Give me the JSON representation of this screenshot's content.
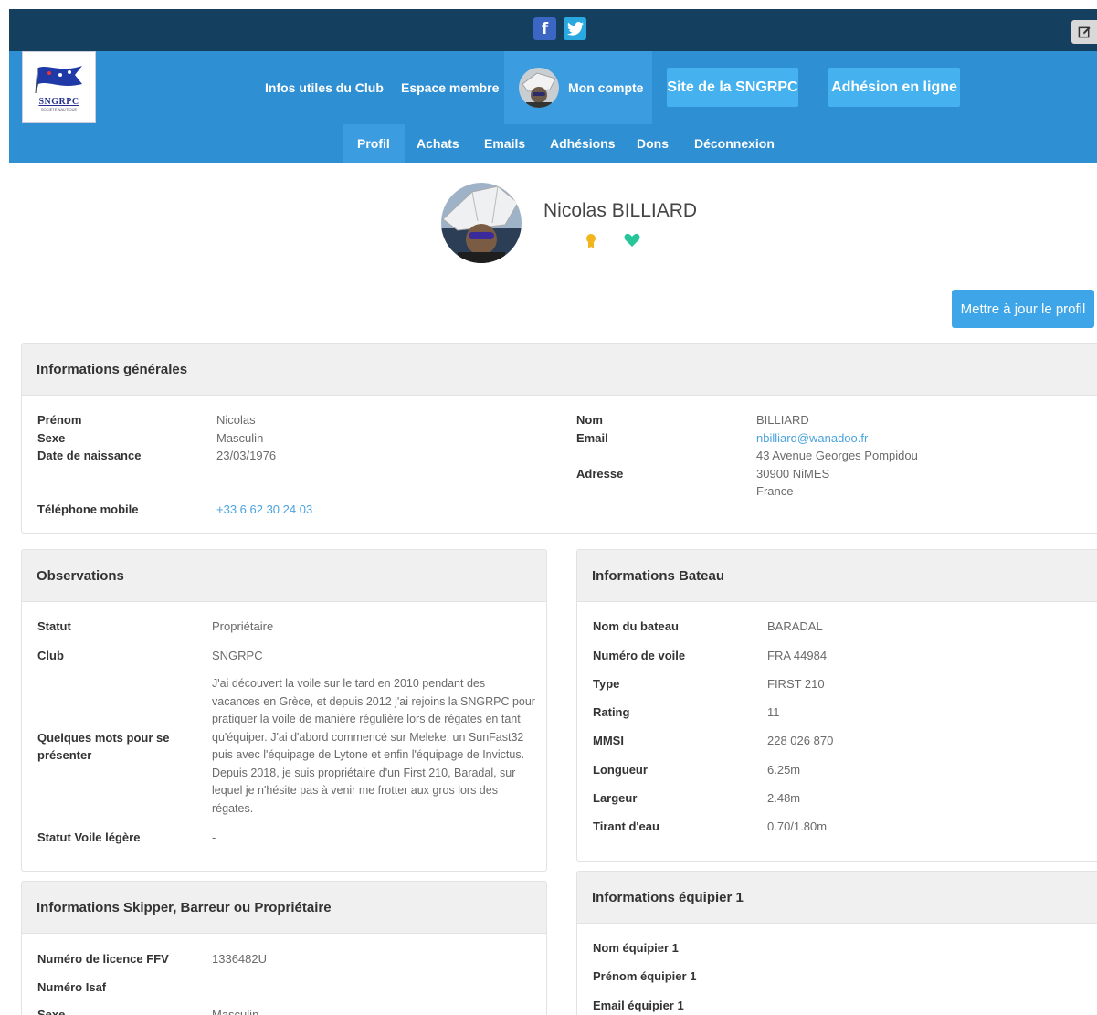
{
  "social": {
    "facebook": "f",
    "twitter": "t"
  },
  "nav": {
    "logo_text": "SNGRPC",
    "logo_sub": "SOCIÉTÉ NAUTIQUE",
    "links": [
      "Infos utiles du Club",
      "Espace membre"
    ],
    "account": "Mon compte",
    "site_btn": "Site de la SNGRPC",
    "adhesion_btn": "Adhésion en ligne"
  },
  "subnav": [
    "Profil",
    "Achats",
    "Emails",
    "Adhésions",
    "Dons",
    "Déconnexion"
  ],
  "profile": {
    "name": "Nicolas BILLIARD",
    "update_btn": "Mettre à jour le profil"
  },
  "general": {
    "title": "Informations générales",
    "left": [
      {
        "label": "Prénom",
        "value": "Nicolas"
      },
      {
        "label": "Sexe",
        "value": "Masculin"
      },
      {
        "label": "Date de naissance",
        "value": "23/03/1976"
      },
      {
        "label": "Téléphone mobile",
        "value": "+33 6 62 30 24 03"
      }
    ],
    "right": {
      "nom_label": "Nom",
      "nom_value": "BILLIARD",
      "email_label": "Email",
      "email_value": "nbilliard@wanadoo.fr",
      "adresse_label": "Adresse",
      "adresse_lines": [
        "43 Avenue Georges Pompidou",
        "30900 NiMES",
        "France"
      ]
    }
  },
  "observations": {
    "title": "Observations",
    "statut_label": "Statut",
    "statut_value": "Propriétaire",
    "club_label": "Club",
    "club_value": "SNGRPC",
    "presenter_label_1": "Quelques mots pour se",
    "presenter_label_2": "présenter",
    "presenter_lines": [
      "J'ai découvert la voile sur le tard en 2010 pendant des",
      "vacances en Grèce, et depuis 2012 j'ai rejoins la SNGRPC pour",
      "pratiquer la voile de manière régulière lors de régates en tant",
      "qu'équiper. J'ai d'abord commencé sur Meleke, un SunFast32",
      "puis avec l'équipage de Lytone et enfin l'équipage de Invictus.",
      "Depuis 2018, je suis propriétaire d'un First 210, Baradal, sur",
      "lequel je n'hésite pas à venir me frotter aux gros lors des",
      "régates."
    ],
    "voile_label": "Statut Voile légère",
    "voile_value": "-"
  },
  "bateau": {
    "title": "Informations Bateau",
    "rows": [
      {
        "label": "Nom du bateau",
        "value": "BARADAL"
      },
      {
        "label": "Numéro de voile",
        "value": "FRA 44984"
      },
      {
        "label": "Type",
        "value": "FIRST 210"
      },
      {
        "label": "Rating",
        "value": "11"
      },
      {
        "label": "MMSI",
        "value": "228 026 870"
      },
      {
        "label": "Longueur",
        "value": "6.25m"
      },
      {
        "label": "Largeur",
        "value": "2.48m"
      },
      {
        "label": "Tirant d'eau",
        "value": "0.70/1.80m"
      }
    ]
  },
  "skipper": {
    "title": "Informations Skipper, Barreur ou Propriétaire",
    "licence_label": "Numéro de licence FFV",
    "licence_value": "1336482U",
    "isaf_label": "Numéro Isaf",
    "sexe_label": "Sexe",
    "sexe_value": "Masculin"
  },
  "equipier": {
    "title": "Informations équipier 1",
    "nom_label": "Nom équipier 1",
    "prenom_label": "Prénom équipier 1",
    "email_label": "Email équipier 1"
  },
  "colors": {
    "topbar": "#153f5e",
    "nav": "#2e8fd2",
    "button": "#45b1ee",
    "link": "#4aa3df",
    "heart": "#26c59a",
    "medal": "#f2b51d"
  },
  "icons": {
    "edit": "edit-icon",
    "medal": "medal-icon",
    "heart": "heart-icon"
  }
}
